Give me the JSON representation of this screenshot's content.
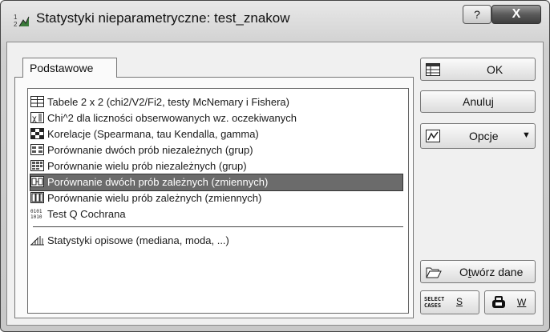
{
  "window": {
    "title": "Statystyki nieparametryczne: test_znakow",
    "help_label": "?",
    "close_label": "X"
  },
  "tabs": [
    {
      "label": "Podstawowe"
    }
  ],
  "list": {
    "items": [
      {
        "label": "Tabele 2 x 2 (chi2/V2/Fi2, testy McNemary i Fishera)",
        "icon": "table-2x2-icon"
      },
      {
        "label": "Chi^2 dla liczności obserwowanych wz. oczekiwanych",
        "icon": "chi-square-icon"
      },
      {
        "label": "Korelacje (Spearmana, tau Kendalla, gamma)",
        "icon": "correlation-icon"
      },
      {
        "label": "Porównanie dwóch prób niezależnych (grup)",
        "icon": "two-independent-samples-icon"
      },
      {
        "label": "Porównanie wielu prób niezależnych (grup)",
        "icon": "many-independent-samples-icon"
      },
      {
        "label": "Porównanie dwóch prób zależnych (zmiennych)",
        "icon": "two-dependent-samples-icon",
        "selected": true
      },
      {
        "label": "Porównanie wielu prób zależnych (zmiennych)",
        "icon": "many-dependent-samples-icon"
      },
      {
        "label": "Test Q Cochrana",
        "icon": "cochran-q-icon"
      },
      {
        "label": "Statystyki opisowe (mediana, moda, ...)",
        "icon": "descriptive-stats-icon"
      }
    ]
  },
  "buttons": {
    "ok": "OK",
    "cancel": "Anuluj",
    "options": "Opcje",
    "open_data_prefix": "O",
    "open_data_accel": "t",
    "open_data_suffix": "wórz dane",
    "select_cases_icon_text": "SELECT CASES",
    "select_cases_label": "S",
    "weights_label": "W"
  }
}
